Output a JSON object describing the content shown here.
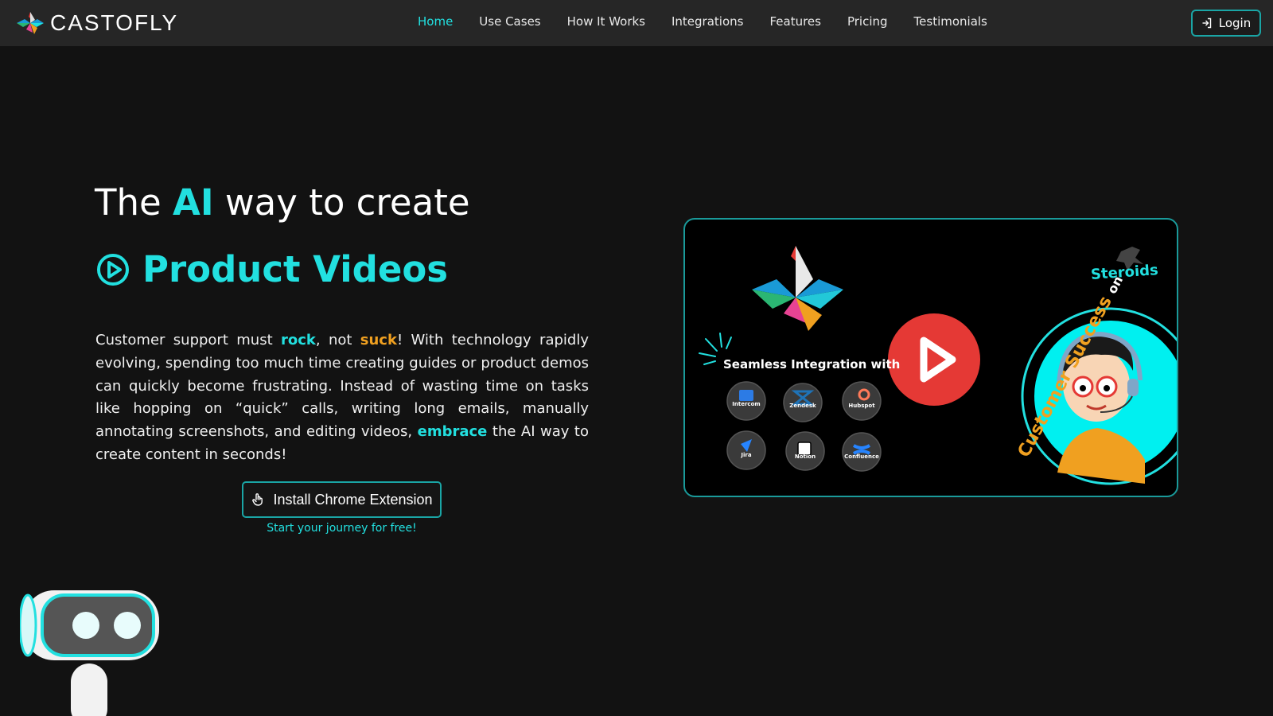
{
  "brand": {
    "name": "CASTOFLY"
  },
  "nav": {
    "links": [
      {
        "label": "Home",
        "active": true
      },
      {
        "label": "Use Cases"
      },
      {
        "label": "How It Works"
      },
      {
        "label": "Integrations"
      },
      {
        "label": "Features"
      },
      {
        "label": "Pricing"
      },
      {
        "label": "Testimonials"
      }
    ],
    "login_label": "Login"
  },
  "hero": {
    "title_pre": "The ",
    "title_ai": "AI",
    "title_post": " way to create",
    "subtitle": "Product Videos",
    "desc": {
      "p1": "Customer support must ",
      "rock": "rock",
      "p2": ", not ",
      "suck": "suck",
      "p3": "! With technology rapidly evolving, spending too much time creating guides or product demos can quickly become frustrating. Instead of wasting time on tasks like hopping on “quick” calls, writing long emails, manually annotating screenshots, and editing videos, ",
      "embrace": "embrace",
      "p4": " the AI way to create content in seconds!"
    },
    "cta_label": "Install Chrome Extension",
    "cta_sub": "Start your journey for free!"
  },
  "video": {
    "seamless": "Seamless Integration with",
    "integrations": [
      "Intercom",
      "Zendesk",
      "Hubspot",
      "Jira",
      "Notion",
      "Confluence"
    ],
    "tagline_a": "Customer Success",
    "tagline_on": "on",
    "tagline_b": "Steroids"
  },
  "colors": {
    "accent": "#22e0e0",
    "highlight": "#f0a020",
    "play": "#e53935",
    "background": "#121212",
    "nav": "#262626"
  }
}
